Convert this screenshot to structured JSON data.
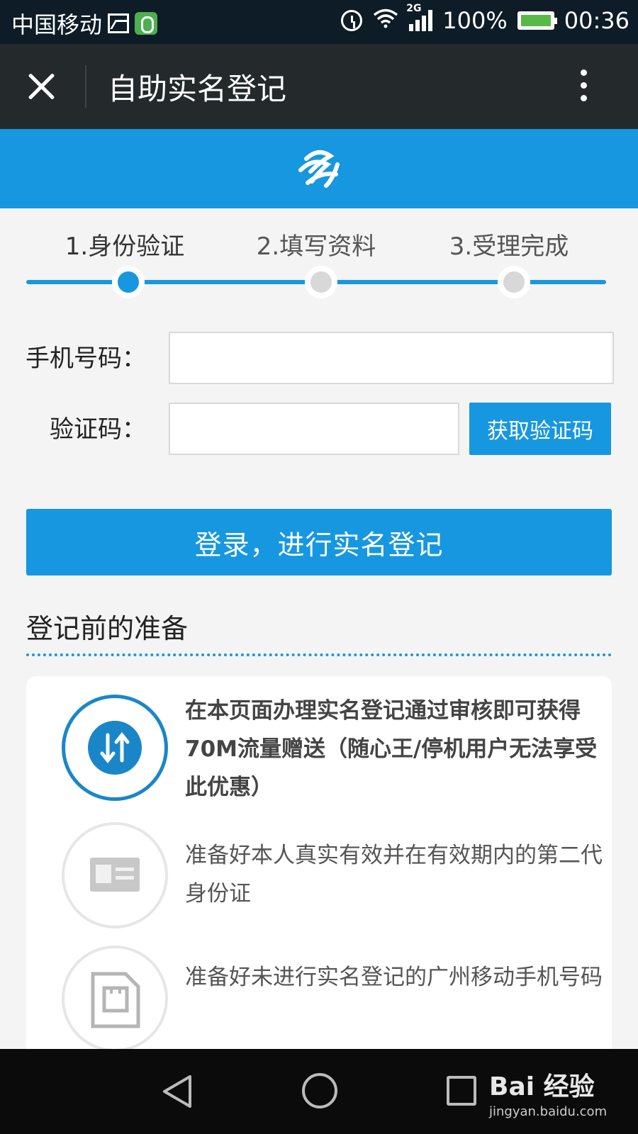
{
  "status_bar": {
    "carrier": "中国移动",
    "network_type": "2G",
    "battery": "100%",
    "time": "00:36",
    "icons": [
      "gallery-icon",
      "app-lock-icon",
      "alarm-icon",
      "wifi-icon",
      "signal-icon",
      "battery-icon"
    ]
  },
  "title_bar": {
    "title": "自助实名登记",
    "close_icon": "close-icon",
    "more_icon": "more-vertical-icon"
  },
  "brand": {
    "logo": "china-mobile-logo",
    "bar_color": "#1797e0"
  },
  "steps": {
    "items": [
      {
        "label": "1.身份验证",
        "active": true
      },
      {
        "label": "2.填写资料",
        "active": false
      },
      {
        "label": "3.受理完成",
        "active": false
      }
    ]
  },
  "form": {
    "phone_label": "手机号码：",
    "phone_value": "",
    "code_label": "验证码：",
    "code_value": "",
    "get_code_label": "获取验证码",
    "submit_label": "登录，进行实名登记"
  },
  "section": {
    "title": "登记前的准备",
    "tips": [
      {
        "icon": "data-transfer-icon",
        "text": "在本页面办理实名登记通过审核即可获得70M流量赠送（随心王/停机用户无法享受此优惠）"
      },
      {
        "icon": "id-card-icon",
        "text": "准备好本人真实有效并在有效期内的第二代身份证"
      },
      {
        "icon": "sim-card-icon",
        "text": "准备好未进行实名登记的广州移动手机号码"
      }
    ]
  },
  "nav_bar": {
    "icons": [
      "back-icon",
      "home-icon",
      "recent-apps-icon"
    ]
  },
  "watermark": {
    "brand": "Bai 经验",
    "url": "jingyan.baidu.com"
  },
  "colors": {
    "accent": "#1797e0",
    "title_bar": "#24292c",
    "status_bar": "#0d1c26",
    "inactive_dot": "#d8d8d8"
  }
}
